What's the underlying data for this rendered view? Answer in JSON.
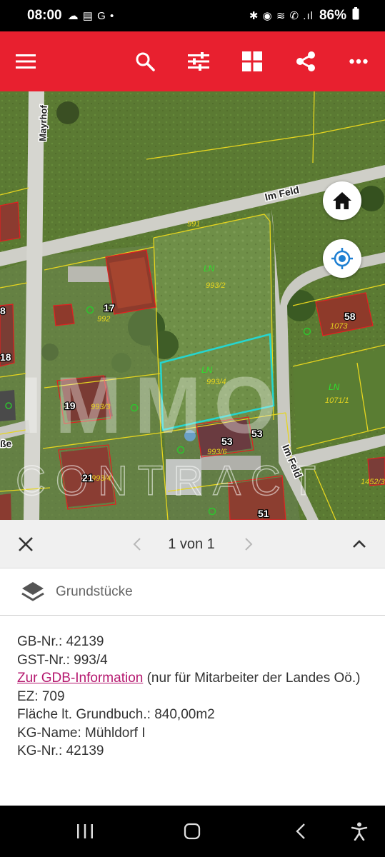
{
  "status": {
    "time": "08:00",
    "left_glyphs": "☁ ▤ G •",
    "right_glyphs": "✱ ◉ ≋ ✆ .ıl",
    "battery": "86%"
  },
  "colors": {
    "brand_red": "#e8202f",
    "link": "#b5186f",
    "selected_parcel": "#25d6d0",
    "parcel_line": "#e6d51f"
  },
  "toolbar": {
    "icons": [
      "menu-icon",
      "search-icon",
      "filter-sliders-icon",
      "grid-apps-icon",
      "share-icon",
      "more-dots-icon"
    ]
  },
  "map": {
    "streets": [
      "Im Feld",
      "Im Feld",
      "Mayrhof",
      "ße"
    ],
    "land_use": [
      "LN",
      "LN",
      "LN"
    ],
    "parcels": [
      "993/2",
      "993/4",
      "993/6",
      "993/3",
      "993/4",
      "1073",
      "1071/1",
      "992",
      "991",
      "1452/3"
    ],
    "house_numbers": [
      "17",
      "19",
      "21",
      "53",
      "53",
      "58",
      "51",
      "8",
      "18"
    ],
    "watermark": {
      "line1": "IMMO",
      "line2": "CONTRACT"
    }
  },
  "pager": {
    "text": "1 von 1"
  },
  "layer": {
    "label": "Grundstücke"
  },
  "info": {
    "gb_nr": "GB-Nr.: 42139",
    "gst_nr": "GST-Nr.: 993/4",
    "gdb_link": "Zur GDB-Information",
    "gdb_note": " (nur für Mitarbeiter der Landes Oö.)",
    "ez": "EZ: 709",
    "flaeche": "Fläche lt. Grundbuch.: 840,00m2",
    "kg_name": "KG-Name: Mühldorf I",
    "kg_nr": "KG-Nr.: 42139"
  }
}
